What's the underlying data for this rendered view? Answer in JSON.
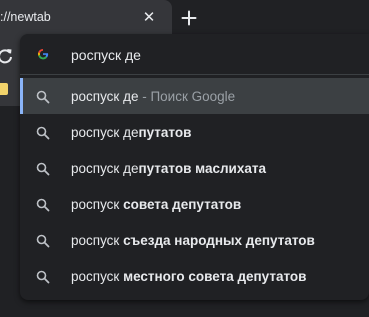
{
  "tab": {
    "title": "://newtab",
    "close_glyph": "✕"
  },
  "omnibox": {
    "input_value": "роспуск де",
    "suggestions": [
      {
        "typed": "роспуск де",
        "rest": "",
        "hint": " - Поиск Google",
        "selected": true
      },
      {
        "typed": "роспуск де",
        "rest": "путатов",
        "hint": ""
      },
      {
        "typed": "роспуск де",
        "rest": "путатов маслихата",
        "hint": ""
      },
      {
        "typed": "роспуск ",
        "rest": "совета де",
        "rest2": "путатов",
        "hint": ""
      },
      {
        "typed": "роспуск ",
        "rest": "съезда народных де",
        "rest2": "путатов",
        "hint": ""
      },
      {
        "typed": "роспуск ",
        "rest": "местного совета де",
        "rest2": "путатов",
        "hint": ""
      }
    ]
  },
  "icons": {
    "omnibox_icon": "google-g-icon",
    "suggestion_icon": "search-icon",
    "tab_close": "close-icon",
    "new_tab": "plus-icon",
    "reload": "reload-icon"
  },
  "colors": {
    "background": "#202124",
    "toolbar": "#35363a",
    "selected_row": "#3c4043",
    "focus_bar": "#8ab4f8",
    "text": "#e8eaed",
    "hint_text": "#9aa0a6"
  }
}
